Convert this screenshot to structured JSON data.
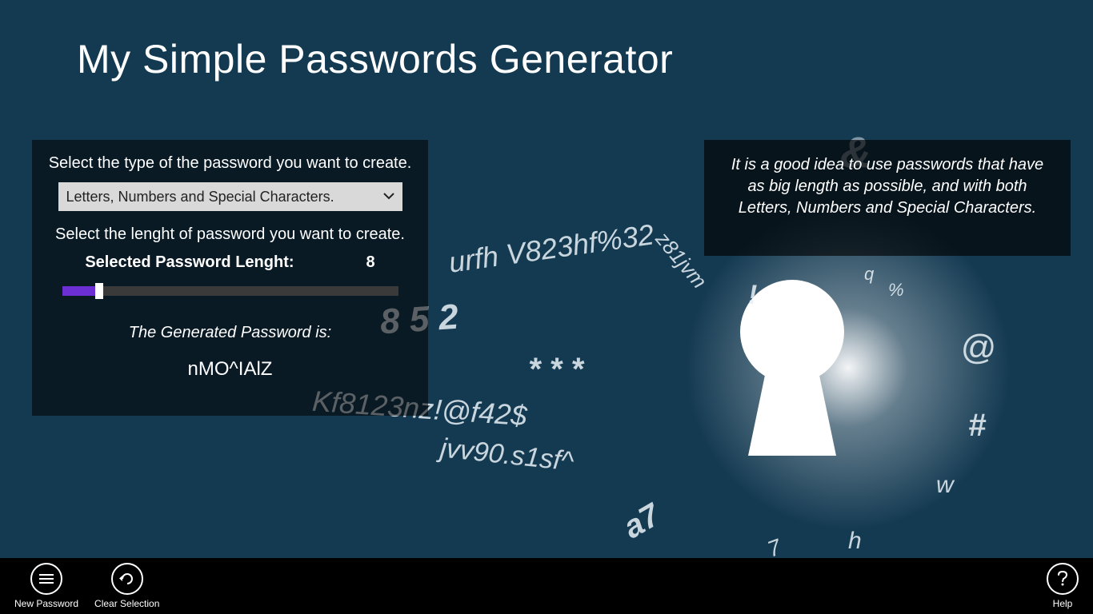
{
  "title": "My Simple Passwords Generator",
  "panel": {
    "type_label": "Select the type of the password you want to create.",
    "type_selected": "Letters, Numbers and Special Characters.",
    "length_label": "Select the lenght of password you want to create.",
    "selected_length_label": "Selected Password Lenght:",
    "selected_length_value": "8",
    "slider_percent": 11,
    "generated_label": "The Generated Password is:",
    "generated_value": "nMO^IAlZ"
  },
  "tip": {
    "text": "It is a good idea to use passwords that have as big length as possible, and with both Letters, Numbers and Special Characters."
  },
  "appbar": {
    "new_password": "New Password",
    "clear_selection": "Clear Selection",
    "help": "Help"
  },
  "bg": {
    "t1": "urfh V823hf%32",
    "t2": "z81jvm",
    "t3": "8 5 2",
    "t4": "* * *",
    "t5": "Kf8123nz!@f42$",
    "t6": "jvv90.s1sf^",
    "t7": "a7",
    "t8": "q",
    "t9": "%",
    "t10": "@",
    "t11": "!",
    "t12": "#",
    "t13": "w",
    "t14": "h",
    "t15": "7",
    "t16": "&"
  }
}
